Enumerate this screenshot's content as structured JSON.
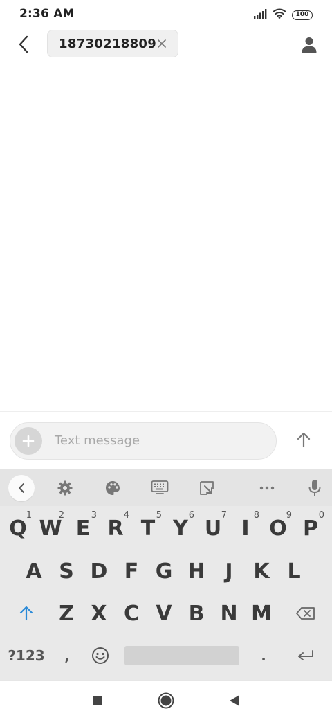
{
  "status_bar": {
    "time": "2:36 AM",
    "battery": "100",
    "icons": [
      "signal-icon",
      "wifi-icon",
      "battery-icon"
    ]
  },
  "header": {
    "recipient": "18730218809",
    "icons": [
      "back-arrow-icon",
      "close-icon",
      "person-icon"
    ]
  },
  "composer": {
    "placeholder": "Text message",
    "icons": [
      "plus-icon",
      "send-arrow-icon"
    ]
  },
  "keyboard": {
    "toolbar_icons": [
      "chevron-left-icon",
      "gear-icon",
      "palette-icon",
      "keyboard-icon",
      "resize-icon",
      "more-icon",
      "mic-icon"
    ],
    "row1": [
      {
        "key": "Q",
        "hint": "1"
      },
      {
        "key": "W",
        "hint": "2"
      },
      {
        "key": "E",
        "hint": "3"
      },
      {
        "key": "R",
        "hint": "4"
      },
      {
        "key": "T",
        "hint": "5"
      },
      {
        "key": "Y",
        "hint": "6"
      },
      {
        "key": "U",
        "hint": "7"
      },
      {
        "key": "I",
        "hint": "8"
      },
      {
        "key": "O",
        "hint": "9"
      },
      {
        "key": "P",
        "hint": "0"
      }
    ],
    "row2": [
      "A",
      "S",
      "D",
      "F",
      "G",
      "H",
      "J",
      "K",
      "L"
    ],
    "row3": [
      "Z",
      "X",
      "C",
      "V",
      "B",
      "N",
      "M"
    ],
    "symbols_label": "?123",
    "comma": ",",
    "period": ".",
    "accent_color": "#2a8ad8"
  },
  "nav_bar": {
    "icons": [
      "recents-icon",
      "home-icon",
      "back-icon"
    ]
  }
}
